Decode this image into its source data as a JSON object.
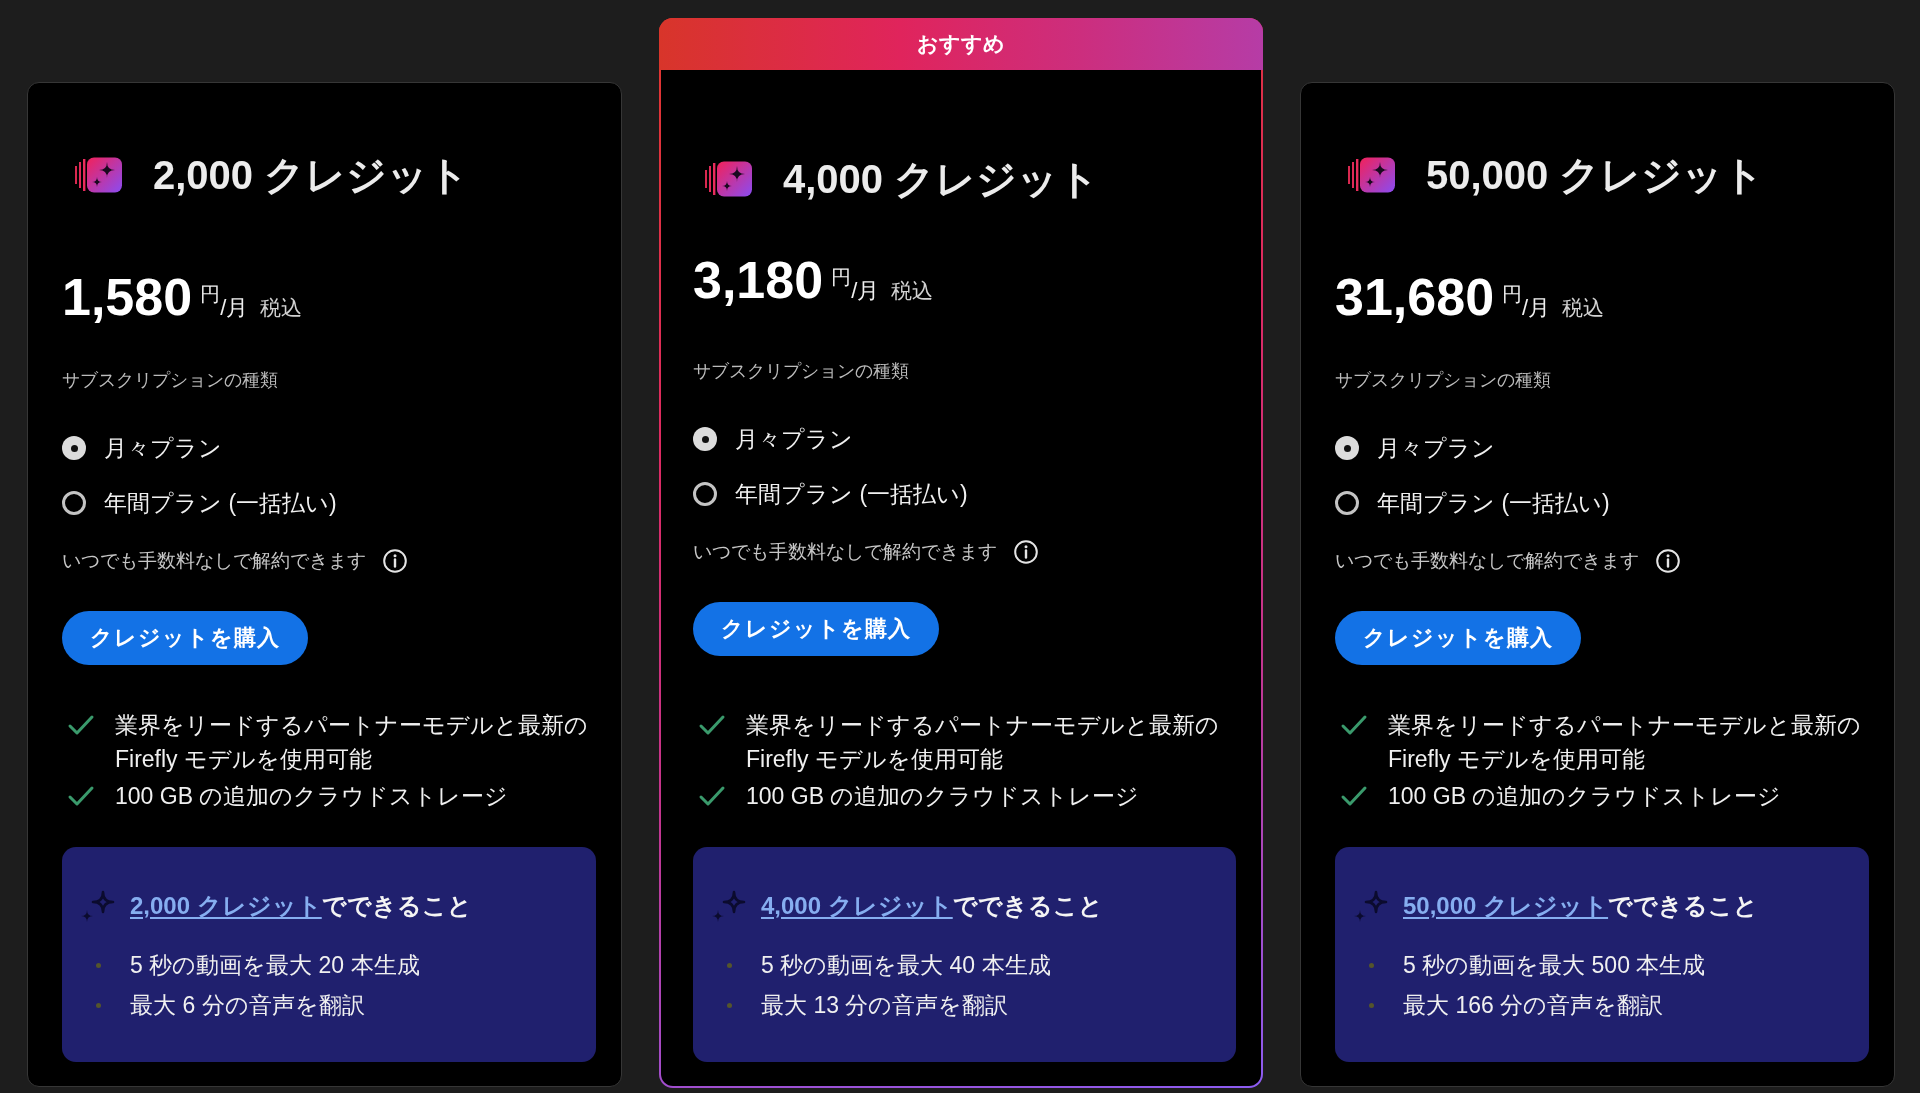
{
  "plans": [
    {
      "title": "2,000 クレジット",
      "price": "1,580",
      "currency": "円",
      "period": "/月",
      "tax_note": "税込",
      "subscription_label": "サブスクリプションの種類",
      "options": [
        {
          "label": "月々プラン",
          "selected": true
        },
        {
          "label": "年間プラン (一括払い)",
          "selected": false
        }
      ],
      "cancel_note": "いつでも手数料なしで解約できます",
      "buy_button": "クレジットを購入",
      "features": [
        "業界をリードするパートナーモデルと最新の Firefly モデルを使用可能",
        "100 GB の追加のクラウドストレージ"
      ],
      "usage": {
        "link": "2,000 クレジット",
        "text": "でできること",
        "items": [
          "5 秒の動画を最大 20 本生成",
          "最大 6 分の音声を翻訳"
        ]
      }
    },
    {
      "badge": "おすすめ",
      "title": "4,000 クレジット",
      "price": "3,180",
      "currency": "円",
      "period": "/月",
      "tax_note": "税込",
      "subscription_label": "サブスクリプションの種類",
      "options": [
        {
          "label": "月々プラン",
          "selected": true
        },
        {
          "label": "年間プラン (一括払い)",
          "selected": false
        }
      ],
      "cancel_note": "いつでも手数料なしで解約できます",
      "buy_button": "クレジットを購入",
      "features": [
        "業界をリードするパートナーモデルと最新の Firefly モデルを使用可能",
        "100 GB の追加のクラウドストレージ"
      ],
      "usage": {
        "link": "4,000 クレジット",
        "text": "でできること",
        "items": [
          "5 秒の動画を最大 40 本生成",
          "最大 13 分の音声を翻訳"
        ]
      }
    },
    {
      "title": "50,000 クレジット",
      "price": "31,680",
      "currency": "円",
      "period": "/月",
      "tax_note": "税込",
      "subscription_label": "サブスクリプションの種類",
      "options": [
        {
          "label": "月々プラン",
          "selected": true
        },
        {
          "label": "年間プラン (一括払い)",
          "selected": false
        }
      ],
      "cancel_note": "いつでも手数料なしで解約できます",
      "buy_button": "クレジットを購入",
      "features": [
        "業界をリードするパートナーモデルと最新の Firefly モデルを使用可能",
        "100 GB の追加のクラウドストレージ"
      ],
      "usage": {
        "link": "50,000 クレジット",
        "text": "でできること",
        "items": [
          "5 秒の動画を最大 500 本生成",
          "最大 166 分の音声を翻訳"
        ]
      }
    }
  ]
}
